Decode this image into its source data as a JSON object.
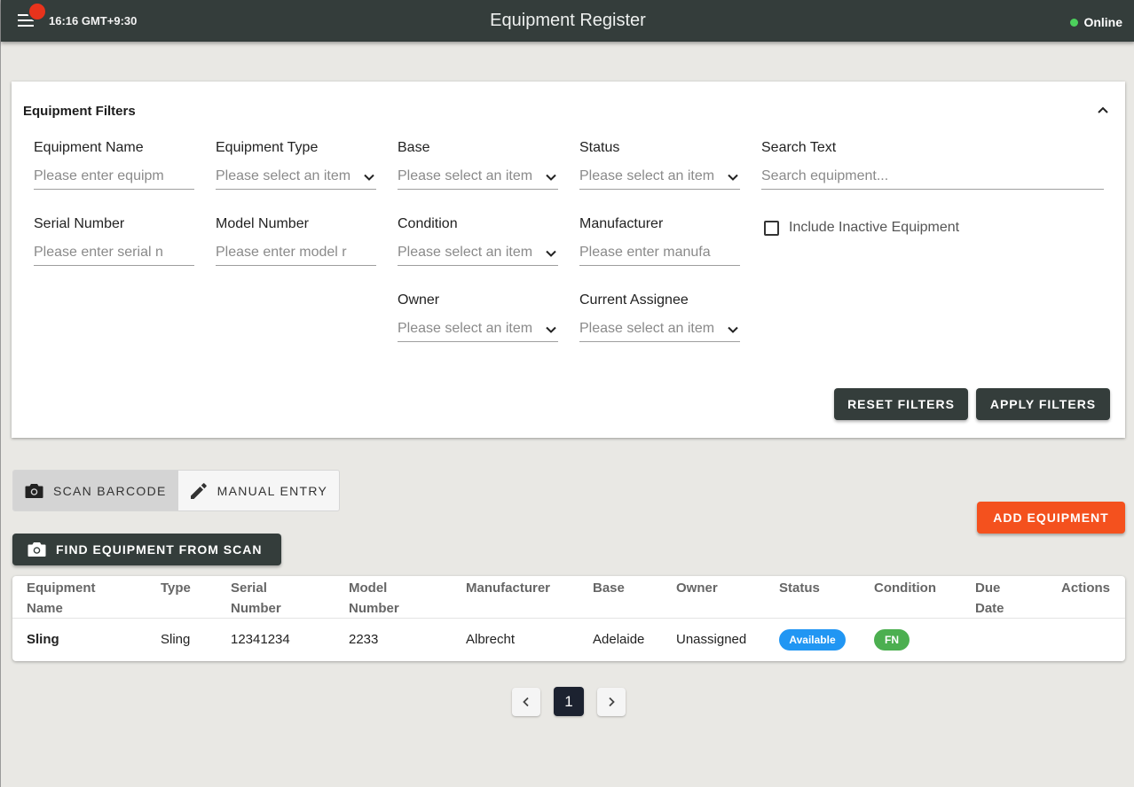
{
  "header": {
    "time": "16:16 GMT+9:30",
    "title": "Equipment Register",
    "status": "Online",
    "status_color": "#4cd15c",
    "badge_color": "#e8331c"
  },
  "filters": {
    "heading": "Equipment Filters",
    "fields": {
      "equipment_name": {
        "label": "Equipment Name",
        "placeholder": "Please enter equipm"
      },
      "equipment_type": {
        "label": "Equipment Type",
        "value": "Please select an item"
      },
      "base": {
        "label": "Base",
        "value": "Please select an item"
      },
      "status": {
        "label": "Status",
        "value": "Please select an item"
      },
      "search_text": {
        "label": "Search Text",
        "placeholder": "Search equipment..."
      },
      "serial_number": {
        "label": "Serial Number",
        "placeholder": "Please enter serial n"
      },
      "model_number": {
        "label": "Model Number",
        "placeholder": "Please enter model r"
      },
      "condition": {
        "label": "Condition",
        "value": "Please select an item"
      },
      "manufacturer": {
        "label": "Manufacturer",
        "placeholder": "Please enter manufa"
      },
      "owner": {
        "label": "Owner",
        "value": "Please select an item"
      },
      "current_assignee": {
        "label": "Current Assignee",
        "value": "Please select an item"
      }
    },
    "include_inactive_label": "Include Inactive Equipment",
    "reset_label": "RESET FILTERS",
    "apply_label": "APPLY FILTERS"
  },
  "scan": {
    "scan_barcode_label": "SCAN BARCODE",
    "manual_entry_label": "MANUAL ENTRY",
    "find_label": "FIND EQUIPMENT FROM SCAN",
    "add_label": "ADD EQUIPMENT",
    "add_color": "#f4511e"
  },
  "table": {
    "headers": {
      "name_1": "Equipment",
      "name_2": "Name",
      "type": "Type",
      "serial_1": "Serial",
      "serial_2": "Number",
      "model_1": "Model",
      "model_2": "Number",
      "manufacturer": "Manufacturer",
      "base": "Base",
      "owner": "Owner",
      "status": "Status",
      "condition": "Condition",
      "due_1": "Due",
      "due_2": "Date",
      "actions": "Actions"
    },
    "rows": [
      {
        "name": "Sling",
        "type": "Sling",
        "serial": "12341234",
        "model": "2233",
        "manufacturer": "Albrecht",
        "base": "Adelaide",
        "owner": "Unassigned",
        "status": "Available",
        "status_color": "#2196f3",
        "condition": "FN",
        "condition_color": "#4caf50"
      }
    ]
  },
  "pagination": {
    "current": "1"
  }
}
